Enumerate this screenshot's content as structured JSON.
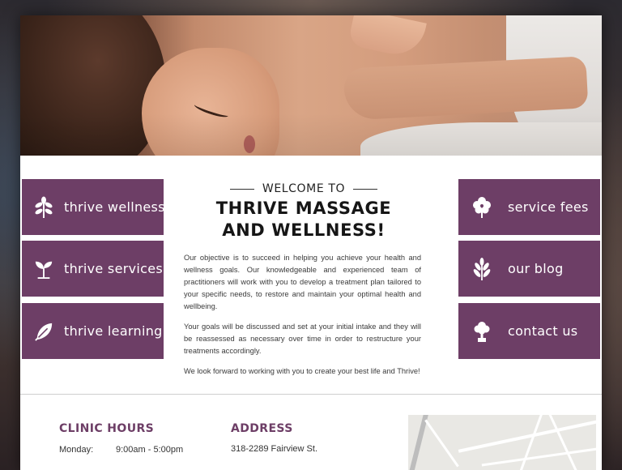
{
  "hero": {
    "description": "woman receiving back massage"
  },
  "nav_left": [
    {
      "label": "thrive wellness",
      "icon": "flower-sprig-icon"
    },
    {
      "label": "thrive services",
      "icon": "sprout-icon"
    },
    {
      "label": "thrive learning",
      "icon": "leaf-icon"
    }
  ],
  "nav_right": [
    {
      "label": "service fees",
      "icon": "flower-icon"
    },
    {
      "label": "our blog",
      "icon": "fern-leaf-icon"
    },
    {
      "label": "contact us",
      "icon": "tree-icon"
    }
  ],
  "welcome": {
    "kicker": "WELCOME TO",
    "headline_1": "THRIVE MASSAGE",
    "headline_2": "AND WELLNESS!",
    "paragraphs": [
      "Our objective is to succeed in helping you achieve your health and wellness goals.  Our knowledgeable and experienced team of practitioners will work with you to develop a treatment plan tailored to your specific needs, to restore and maintain your optimal health and wellbeing.",
      "Your goals will be discussed and set at your initial intake and they will be reassessed as necessary over time in order to restructure your treatments accordingly.",
      "We look forward to working with you to create your best life and Thrive!"
    ]
  },
  "clinic_hours": {
    "title": "CLINIC HOURS",
    "rows": [
      {
        "day": "Monday:",
        "time": "9:00am - 5:00pm"
      }
    ]
  },
  "address": {
    "title": "ADDRESS",
    "line1": "318-2289 Fairview St."
  },
  "colors": {
    "accent": "#6d3e66",
    "text": "#333333",
    "background": "#ffffff"
  }
}
